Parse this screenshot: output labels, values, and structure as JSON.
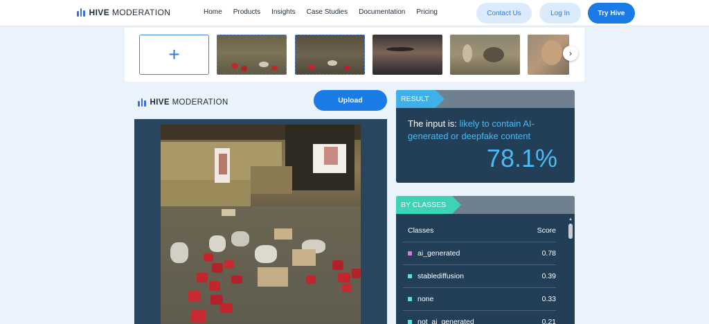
{
  "brand": {
    "bold": "HIVE",
    "light": "MODERATION"
  },
  "nav": {
    "items": [
      "Home",
      "Products",
      "Insights",
      "Case Studies",
      "Documentation",
      "Pricing"
    ],
    "contact": "Contact Us",
    "login": "Log In",
    "try": "Try Hive"
  },
  "strip": {
    "add": "+",
    "next_icon": "chevron-right-icon"
  },
  "left": {
    "upload": "Upload"
  },
  "result": {
    "tag": "RESULT",
    "prefix": "The input is: ",
    "verdict": "likely to contain AI-generated or deepfake content",
    "score": "78.1%"
  },
  "classes": {
    "tag": "BY CLASSES",
    "col_class": "Classes",
    "col_score": "Score",
    "rows": [
      {
        "name": "ai_generated",
        "score": "0.78",
        "color": "#d57ae6"
      },
      {
        "name": "stablediffusion",
        "score": "0.39",
        "color": "#58e3e0"
      },
      {
        "name": "none",
        "score": "0.33",
        "color": "#58e3e0"
      },
      {
        "name": "not_ai_generated",
        "score": "0.21",
        "color": "#58e3e0"
      }
    ]
  },
  "colors": {
    "accent": "#1a7ae6",
    "highlight": "#48b9f2",
    "card": "#233f58"
  }
}
